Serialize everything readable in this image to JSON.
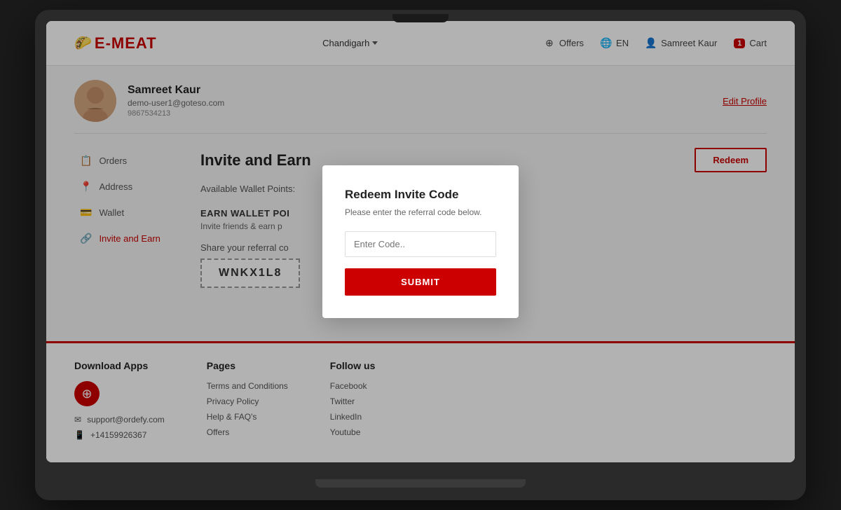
{
  "header": {
    "logo_text": "E-MEAT",
    "logo_emoji": "🌮",
    "location": "Chandigarh",
    "nav": {
      "offers_label": "Offers",
      "language_label": "EN",
      "user_label": "Samreet Kaur",
      "cart_label": "Cart",
      "cart_count": "1"
    }
  },
  "profile": {
    "name": "Samreet Kaur",
    "email": "demo-user1@goteso.com",
    "phone": "9867534213",
    "edit_label": "Edit Profile"
  },
  "sidebar": {
    "items": [
      {
        "label": "Orders",
        "icon": "📋"
      },
      {
        "label": "Address",
        "icon": "📍"
      },
      {
        "label": "Wallet",
        "icon": "💳"
      },
      {
        "label": "Invite and Earn",
        "icon": "🔗"
      }
    ]
  },
  "main": {
    "section_title": "Invite and Earn",
    "redeem_btn_label": "Redeem",
    "wallet_points_label": "Available Wallet Points:",
    "earn_wallet_title": "EARN WALLET POI",
    "earn_wallet_desc": "Invite friends & earn p",
    "referral_label": "Share your referral co",
    "referral_code": "WNKX1L8"
  },
  "modal": {
    "title": "Redeem Invite Code",
    "subtitle": "Please enter the referral code below.",
    "input_placeholder": "Enter Code..",
    "submit_label": "SUBMIT"
  },
  "footer": {
    "download_title": "Download Apps",
    "support_email": "support@ordefy.com",
    "phone": "+14159926367",
    "pages_title": "Pages",
    "pages_links": [
      "Terms and Conditions",
      "Privacy Policy",
      "Help & FAQ's",
      "Offers"
    ],
    "follow_title": "Follow us",
    "follow_links": [
      "Facebook",
      "Twitter",
      "LinkedIn",
      "Youtube"
    ]
  }
}
